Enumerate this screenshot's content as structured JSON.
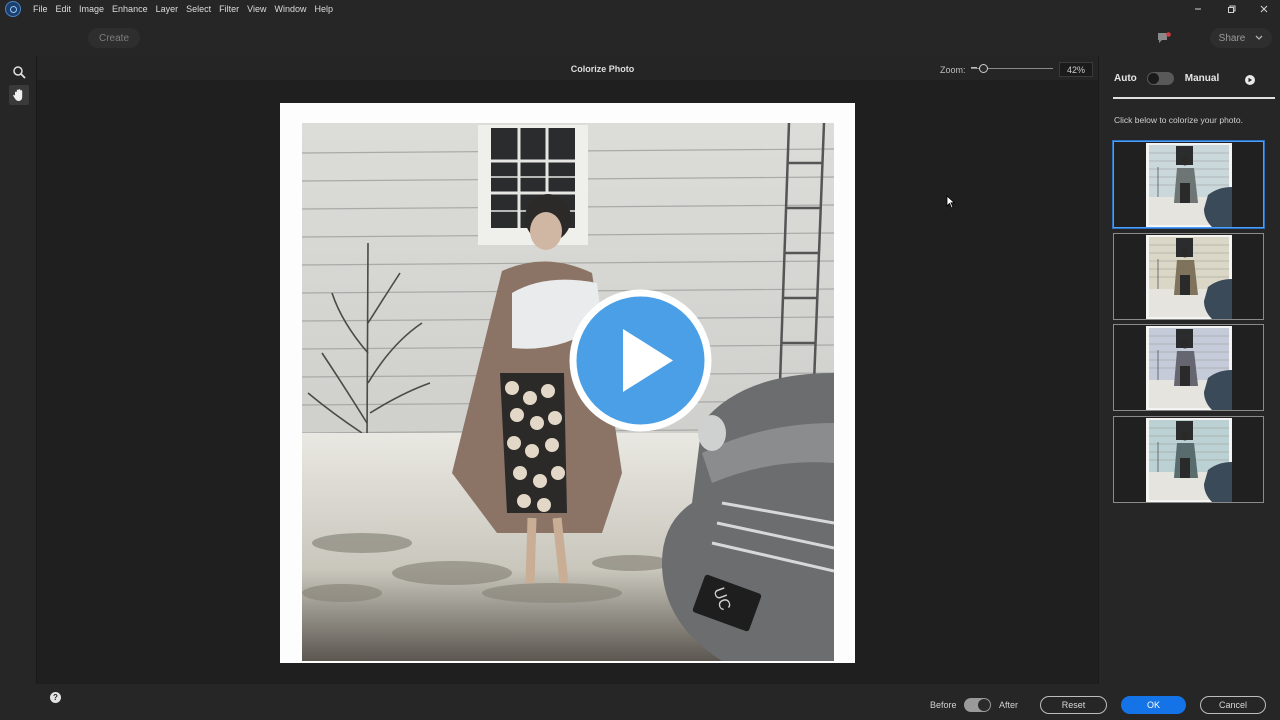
{
  "menubar": {
    "items": [
      "File",
      "Edit",
      "Image",
      "Enhance",
      "Layer",
      "Select",
      "Filter",
      "View",
      "Window",
      "Help"
    ],
    "window_controls": [
      "minimize",
      "restore",
      "close"
    ]
  },
  "toolbar": {
    "create_label": "Create",
    "share_label": "Share"
  },
  "left_tools": {
    "zoom_tool": "zoom-tool-icon",
    "hand_tool": "hand-tool-icon"
  },
  "canvas": {
    "title": "Colorize Photo",
    "zoom_label": "Zoom:",
    "zoom_value": "42%"
  },
  "right_panel": {
    "auto_label": "Auto",
    "manual_label": "Manual",
    "hint": "Click below to colorize your photo.",
    "variations": [
      {
        "label": "variation-1",
        "selected": true,
        "tint": "#7fa3b3"
      },
      {
        "label": "variation-2",
        "selected": false,
        "tint": "#a9a079"
      },
      {
        "label": "variation-3",
        "selected": false,
        "tint": "#6c7fa8"
      },
      {
        "label": "variation-4",
        "selected": false,
        "tint": "#4f8f9e"
      }
    ]
  },
  "bottombar": {
    "help": "?",
    "before_label": "Before",
    "after_label": "After",
    "reset_label": "Reset",
    "ok_label": "OK",
    "cancel_label": "Cancel"
  },
  "colors": {
    "accent": "#1473e6",
    "play_button": "#4a9fe6",
    "selection": "#4aa0ff"
  }
}
